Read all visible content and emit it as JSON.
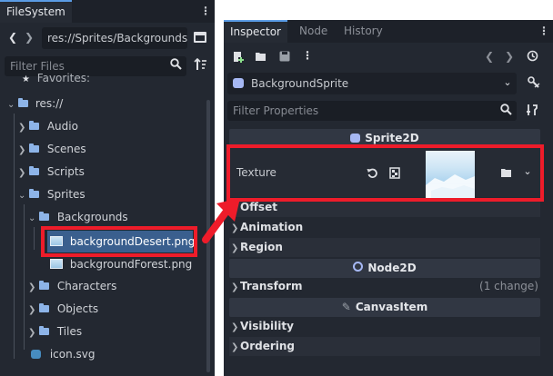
{
  "filesystem": {
    "tab": "FileSystem",
    "path": "res://Sprites/Backgrounds",
    "filter_placeholder": "Filter Files",
    "tree": [
      {
        "label": "Favorites:",
        "kind": "star"
      },
      {
        "label": "res://",
        "kind": "folder-open"
      },
      {
        "label": "Audio",
        "kind": "folder"
      },
      {
        "label": "Scenes",
        "kind": "folder"
      },
      {
        "label": "Scripts",
        "kind": "folder"
      },
      {
        "label": "Sprites",
        "kind": "folder-open"
      },
      {
        "label": "Backgrounds",
        "kind": "folder-open"
      },
      {
        "label": "backgroundDesert.png",
        "kind": "image",
        "selected": true
      },
      {
        "label": "backgroundForest.png",
        "kind": "image"
      },
      {
        "label": "Characters",
        "kind": "folder"
      },
      {
        "label": "Objects",
        "kind": "folder"
      },
      {
        "label": "Tiles",
        "kind": "folder"
      },
      {
        "label": "icon.svg",
        "kind": "svg"
      }
    ]
  },
  "inspector": {
    "tabs": [
      "Inspector",
      "Node",
      "History"
    ],
    "node_name": "BackgroundSprite",
    "filter_placeholder": "Filter Properties",
    "sections": {
      "sprite2d": "Sprite2D",
      "node2d": "Node2D",
      "canvasitem": "CanvasItem"
    },
    "texture_label": "Texture",
    "props": {
      "offset": "Offset",
      "animation": "Animation",
      "region": "Region",
      "transform": "Transform",
      "transform_note": "(1 change)",
      "visibility": "Visibility",
      "ordering": "Ordering"
    }
  },
  "colors": {
    "highlight": "#ee1c2a",
    "accent": "#5a9be4",
    "panel": "#232831"
  }
}
